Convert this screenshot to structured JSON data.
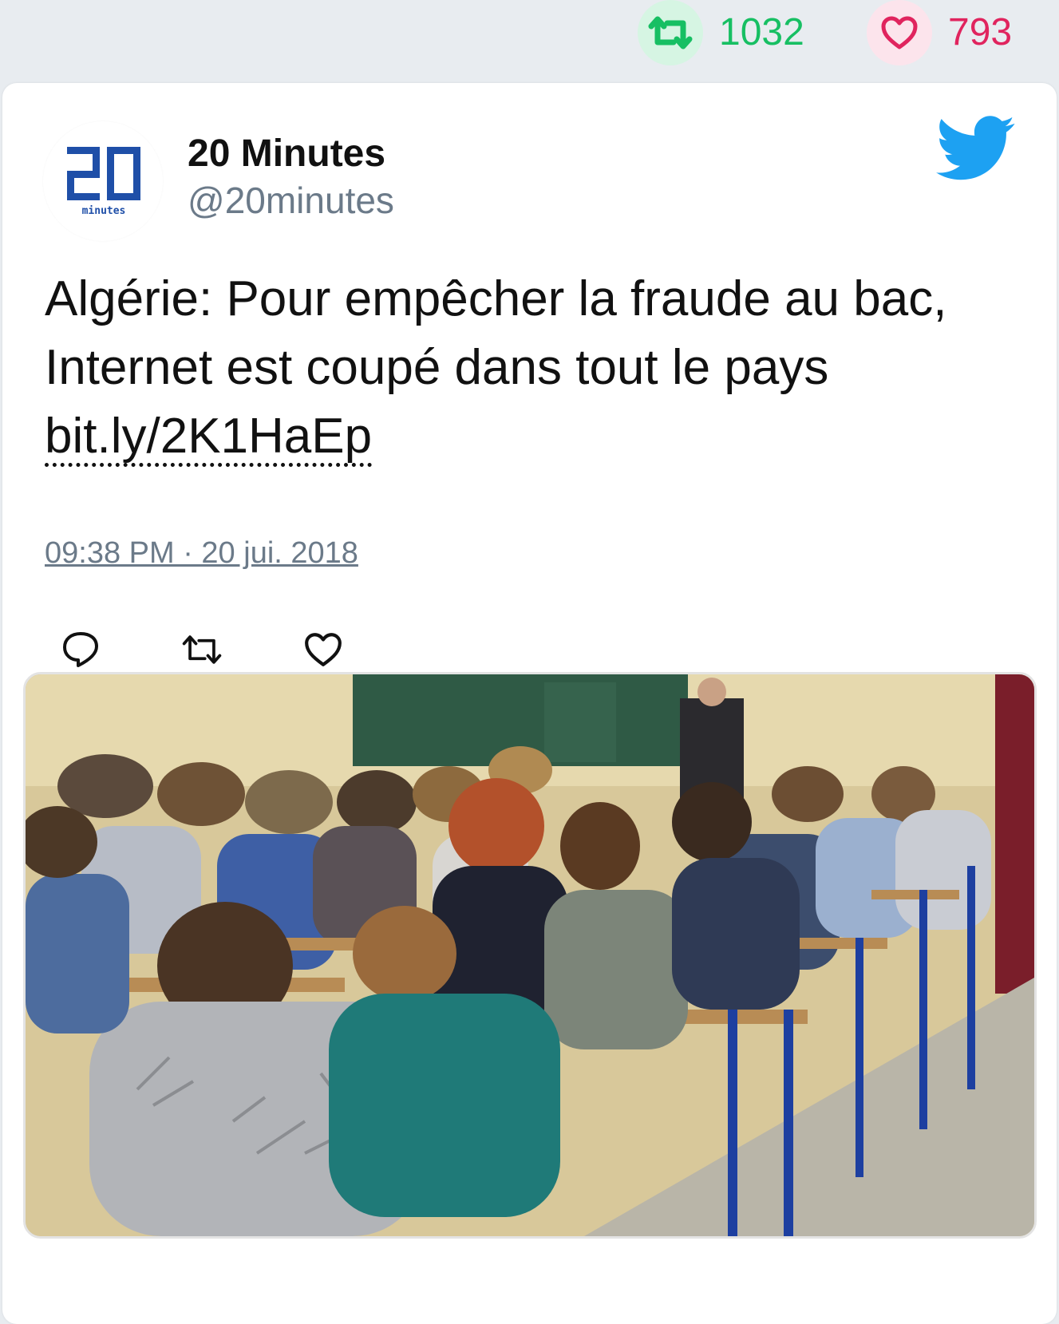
{
  "stats": {
    "retweet_count": "1032",
    "like_count": "793",
    "retweet_icon": "retweet-icon",
    "like_icon": "heart-icon",
    "retweet_color": "#17bf63",
    "like_color": "#e0245e"
  },
  "tweet": {
    "author_name": "20 Minutes",
    "author_handle": "@20minutes",
    "avatar_text": "20",
    "avatar_subtext": "minutes",
    "text_line1": "Algérie: Pour empêcher la fraude au bac,",
    "text_line2": "Internet est coupé dans tout le pays",
    "link": "bit.ly/2K1HaEp",
    "timestamp": "09:38 PM · 20 jui. 2018",
    "brand_color": "#1da1f2"
  },
  "actions": {
    "reply_icon": "reply-icon",
    "retweet_icon": "retweet-icon",
    "like_icon": "heart-icon"
  },
  "media": {
    "image": "photo of students taking an exam in a classroom"
  }
}
